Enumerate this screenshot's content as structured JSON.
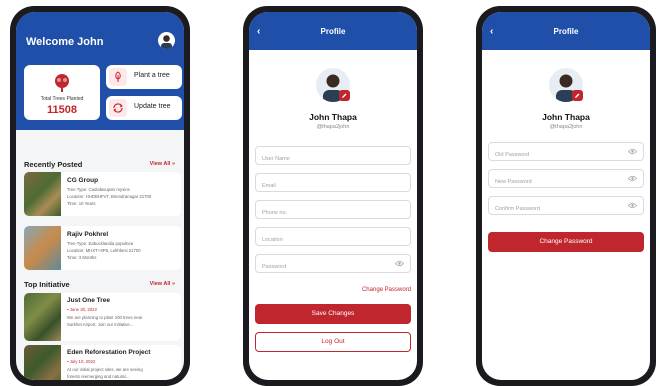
{
  "home": {
    "welcome": "Welcome John",
    "total_label": "Total Trees Planted",
    "total_value": "11508",
    "actions": [
      {
        "label": "Plant a tree"
      },
      {
        "label": "Update tree"
      }
    ],
    "recently_posted": {
      "title": "Recently Posted",
      "view_all": "View All »",
      "items": [
        {
          "name": "CG Group",
          "lines": [
            "Tree Type: Castalavupsis mysins",
            "Location: HHDBHFVT, Birendranagar 21700",
            "Time: 10 Years"
          ]
        },
        {
          "name": "Rajiv Pokhrel",
          "lines": [
            "Tree Type: Eabucklandia populnea",
            "Location: MHXT+9P5, Lekhbesi 21700",
            "Time: 3 Months"
          ]
        }
      ]
    },
    "top_initiative": {
      "title": "Top Initiative",
      "view_all": "View All »",
      "items": [
        {
          "name": "Just One Tree",
          "date": "June 30, 2022",
          "lines": [
            "We are planning to plant 100 trees near",
            "Surkhet Airport. Join our initiative..."
          ]
        },
        {
          "name": "Eden Reforestation Project",
          "date": "July 10, 2022",
          "lines": [
            "At our initial project sites, we are seeing",
            "forests reemerging and natural..."
          ]
        }
      ]
    }
  },
  "profile": {
    "title": "Profile",
    "back": "‹",
    "name": "John Thapa",
    "handle": "@thapa2john",
    "fields": [
      {
        "placeholder": "User Name"
      },
      {
        "placeholder": "Email"
      },
      {
        "placeholder": "Phone no."
      },
      {
        "placeholder": "Location"
      },
      {
        "placeholder": "Password"
      }
    ],
    "change_password_link": "Change Password",
    "save_label": "Save Changes",
    "logout_label": "Log Out"
  },
  "password": {
    "title": "Profile",
    "back": "‹",
    "name": "John Thapa",
    "handle": "@thapa2john",
    "fields": [
      {
        "placeholder": "Old Password"
      },
      {
        "placeholder": "New Password"
      },
      {
        "placeholder": "Confirm Password"
      }
    ],
    "submit_label": "Change Password"
  },
  "colors": {
    "primary_blue": "#1f4fa8",
    "accent_red": "#c0262e",
    "background": "#f4f5f7"
  },
  "icons": [
    "tree-icon",
    "refresh-icon",
    "eye-icon",
    "edit-icon",
    "back-icon",
    "calendar-icon"
  ]
}
